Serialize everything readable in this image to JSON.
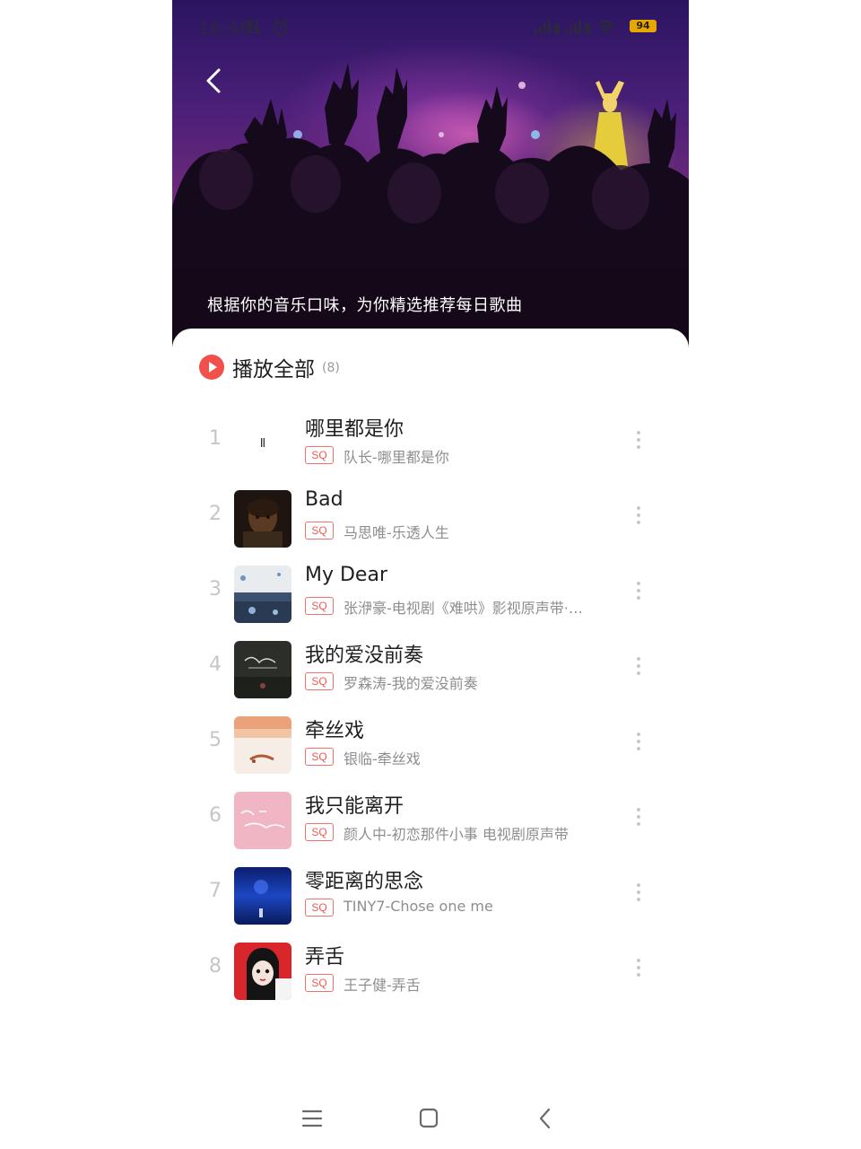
{
  "status_bar": {
    "time": "16:48",
    "battery": "94",
    "icons": [
      "mute-icon",
      "alarm-icon",
      "signal-icon",
      "signal-icon",
      "wifi-icon",
      "battery-icon"
    ]
  },
  "header": {
    "caption": "根据你的音乐口味，为你精选推荐每日歌曲"
  },
  "play_all": {
    "label": "播放全部",
    "count": "(8)"
  },
  "songs": [
    {
      "num": "1",
      "title": "哪里都是你",
      "badge": "SQ",
      "subtitle": "队长-哪里都是你",
      "cover": "playing"
    },
    {
      "num": "2",
      "title": "Bad",
      "badge": "SQ",
      "subtitle": "马思唯-乐透人生",
      "cover": "dark-portrait"
    },
    {
      "num": "3",
      "title": "My Dear",
      "badge": "SQ",
      "subtitle": "张洢豪-电视剧《难哄》影视原声带·…",
      "cover": "blue-white"
    },
    {
      "num": "4",
      "title": "我的爱没前奏",
      "badge": "SQ",
      "subtitle": "罗森涛-我的爱没前奏",
      "cover": "dark-text"
    },
    {
      "num": "5",
      "title": "牵丝戏",
      "badge": "SQ",
      "subtitle": "银临-牵丝戏",
      "cover": "peach"
    },
    {
      "num": "6",
      "title": "我只能离开",
      "badge": "SQ",
      "subtitle": "颜人中-初恋那件小事 电视剧原声带",
      "cover": "pink"
    },
    {
      "num": "7",
      "title": "零距离的思念",
      "badge": "SQ",
      "subtitle": "TINY7-Chose one me",
      "cover": "deep-blue"
    },
    {
      "num": "8",
      "title": "弄舌",
      "badge": "SQ",
      "subtitle": "王子健-弄舌",
      "cover": "anime-girl"
    }
  ],
  "nav": {
    "icons": [
      "menu-icon",
      "home-icon",
      "back-icon"
    ]
  }
}
